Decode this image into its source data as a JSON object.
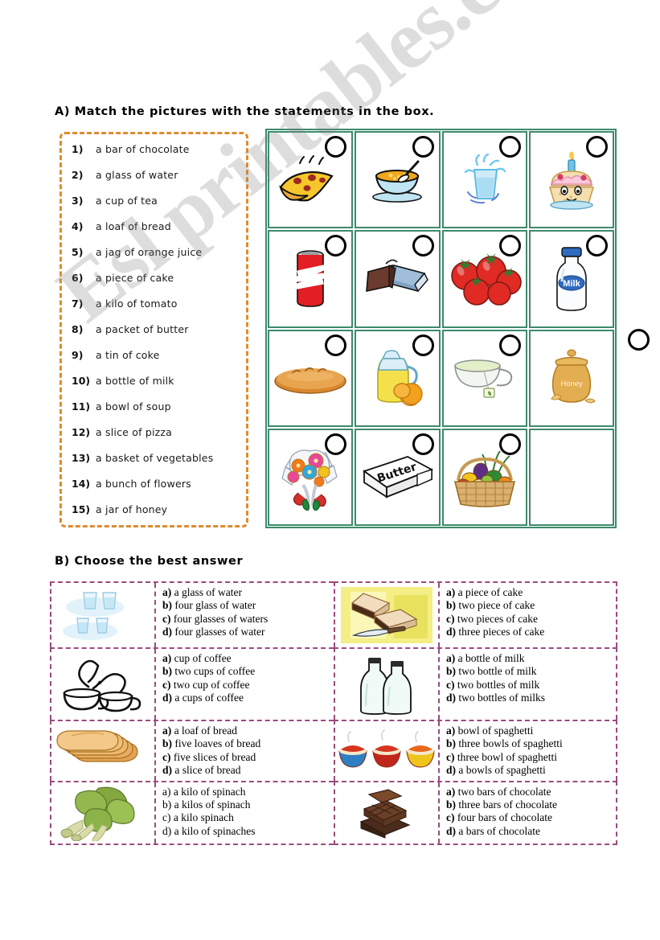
{
  "watermark": {
    "text": "Esl printables.com"
  },
  "section_a": {
    "heading": "A) Match the pictures with the statements in the box.",
    "statements": [
      {
        "num": "1)",
        "text": "a bar of chocolate"
      },
      {
        "num": "2)",
        "text": "a glass of water"
      },
      {
        "num": "3)",
        "text": "a cup of tea"
      },
      {
        "num": "4)",
        "text": "a loaf of bread"
      },
      {
        "num": "5)",
        "text": "a jag of orange juice"
      },
      {
        "num": "6)",
        "text": "a piece of cake"
      },
      {
        "num": "7)",
        "text": "a kilo of tomato"
      },
      {
        "num": "8)",
        "text": "a packet of butter"
      },
      {
        "num": "9)",
        "text": "a tin of coke"
      },
      {
        "num": "10)",
        "text": "a bottle of milk"
      },
      {
        "num": "11)",
        "text": "a bowl of soup"
      },
      {
        "num": "12)",
        "text": "a slice of pizza"
      },
      {
        "num": "13)",
        "text": "a basket of vegetables"
      },
      {
        "num": "14)",
        "text": "a bunch of flowers"
      },
      {
        "num": "15)",
        "text": "a jar of honey"
      }
    ],
    "grid": {
      "colors": {
        "border": "#3D8A6B",
        "statements_border": "#DE8C2F"
      },
      "cells": [
        {
          "picture": "pizza-slice-icon",
          "has_circle": true
        },
        {
          "picture": "bowl-of-soup-icon",
          "has_circle": true
        },
        {
          "picture": "glass-of-water-icon",
          "has_circle": true
        },
        {
          "picture": "cupcake-icon",
          "has_circle": true
        },
        {
          "picture": "coke-can-icon",
          "has_circle": true
        },
        {
          "picture": "chocolate-bar-icon",
          "has_circle": true
        },
        {
          "picture": "tomatoes-icon",
          "has_circle": true
        },
        {
          "picture": "milk-bottle-icon",
          "has_circle": true
        },
        {
          "picture": "bread-loaf-icon",
          "has_circle": true
        },
        {
          "picture": "juice-jug-icon",
          "has_circle": true
        },
        {
          "picture": "cup-of-tea-icon",
          "has_circle": true
        },
        {
          "picture": "honey-jar-icon",
          "has_circle": false
        },
        {
          "picture": "flower-bouquet-icon",
          "has_circle": true
        },
        {
          "picture": "butter-packet-icon",
          "has_circle": true
        },
        {
          "picture": "vegetable-basket-icon",
          "has_circle": true
        },
        {
          "picture": "empty-cell",
          "has_circle": false
        }
      ],
      "milk_label": "Milk",
      "butter_label": "Butter",
      "honey_label": "Honey"
    }
  },
  "section_b": {
    "heading": "B) Choose the best answer",
    "border_color": "#9B4A7E",
    "questions": [
      {
        "picture": "four-glasses-of-water-icon",
        "bold_letters": true,
        "options": [
          {
            "letter": "a)",
            "text": "a glass of water"
          },
          {
            "letter": "b)",
            "text": "four glass of water"
          },
          {
            "letter": "c)",
            "text": "four glasses of waters"
          },
          {
            "letter": "d)",
            "text": "four glasses of water"
          }
        ]
      },
      {
        "picture": "cake-slices-icon",
        "bold_letters": true,
        "options": [
          {
            "letter": "a)",
            "text": "a piece of cake"
          },
          {
            "letter": "b)",
            "text": "two piece of cake"
          },
          {
            "letter": "c)",
            "text": "two pieces of cake"
          },
          {
            "letter": "d)",
            "text": "three pieces of cake"
          }
        ]
      },
      {
        "picture": "two-coffee-cups-icon",
        "bold_letters": true,
        "options": [
          {
            "letter": "a)",
            "text": "cup of coffee"
          },
          {
            "letter": "b)",
            "text": "two cups of coffee"
          },
          {
            "letter": "c)",
            "text": "two cup of coffee"
          },
          {
            "letter": "d)",
            "text": "a cups of coffee"
          }
        ]
      },
      {
        "picture": "two-milk-bottles-icon",
        "bold_letters": true,
        "options": [
          {
            "letter": "a)",
            "text": "a bottle of milk"
          },
          {
            "letter": "b)",
            "text": "two bottle of milk"
          },
          {
            "letter": "c)",
            "text": "two bottles of milk"
          },
          {
            "letter": "d)",
            "text": "two bottles of milks"
          }
        ]
      },
      {
        "picture": "bread-slices-icon",
        "bold_letters": true,
        "options": [
          {
            "letter": "a)",
            "text": "a loaf of bread"
          },
          {
            "letter": "b)",
            "text": "five loaves of bread"
          },
          {
            "letter": "c)",
            "text": "five slices of bread"
          },
          {
            "letter": "d)",
            "text": "a slice of bread"
          }
        ]
      },
      {
        "picture": "three-spaghetti-bowls-icon",
        "bold_letters": true,
        "options": [
          {
            "letter": "a)",
            "text": "bowl of spaghetti"
          },
          {
            "letter": "b)",
            "text": "three bowls of spaghetti"
          },
          {
            "letter": "c)",
            "text": "three bowl of spaghetti"
          },
          {
            "letter": "d)",
            "text": "a bowls of spaghetti"
          }
        ]
      },
      {
        "picture": "spinach-bunch-icon",
        "bold_letters": false,
        "options": [
          {
            "letter": "a)",
            "text": "a kilo of spinach"
          },
          {
            "letter": "b)",
            "text": "a kilos of spinach"
          },
          {
            "letter": "c)",
            "text": "a kilo spinach"
          },
          {
            "letter": "d)",
            "text": "a kilo of spinaches"
          }
        ]
      },
      {
        "picture": "chocolate-bars-icon",
        "bold_letters": true,
        "options": [
          {
            "letter": "a)",
            "text": "two bars of chocolate"
          },
          {
            "letter": "b)",
            "text": "three bars of chocolate"
          },
          {
            "letter": "c)",
            "text": "four bars of chocolate"
          },
          {
            "letter": "d)",
            "text": "a bars of chocolate"
          }
        ]
      }
    ]
  }
}
